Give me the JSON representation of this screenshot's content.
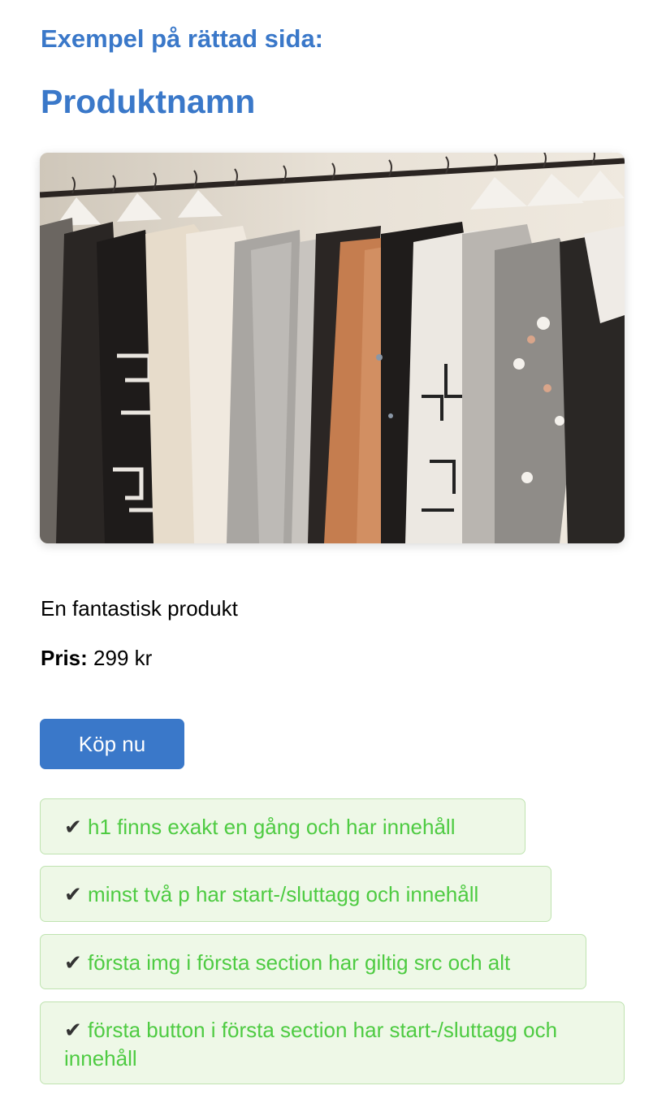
{
  "page": {
    "example_heading": "Exempel på rättad sida:",
    "product_title": "Produktnamn",
    "description": "En fantastisk produkt",
    "price_label": "Pris:",
    "price_value": "299 kr",
    "buy_button_label": "Köp nu"
  },
  "checks": [
    {
      "mark": "✔",
      "text": "h1 finns exakt en gång och har innehåll"
    },
    {
      "mark": "✔",
      "text": "minst två p har start-/sluttagg och innehåll"
    },
    {
      "mark": "✔",
      "text": "första img i första section har giltig src och alt"
    },
    {
      "mark": "✔",
      "text": "första button i första section har start-/sluttagg och innehåll"
    }
  ],
  "colors": {
    "heading_blue": "#3a78c9",
    "button_blue": "#3a78c9",
    "check_text_green": "#4ecb42",
    "check_bg": "#eef8e7",
    "check_border": "#bfe3b0"
  },
  "image": {
    "subject": "clothing-rack-photo"
  }
}
